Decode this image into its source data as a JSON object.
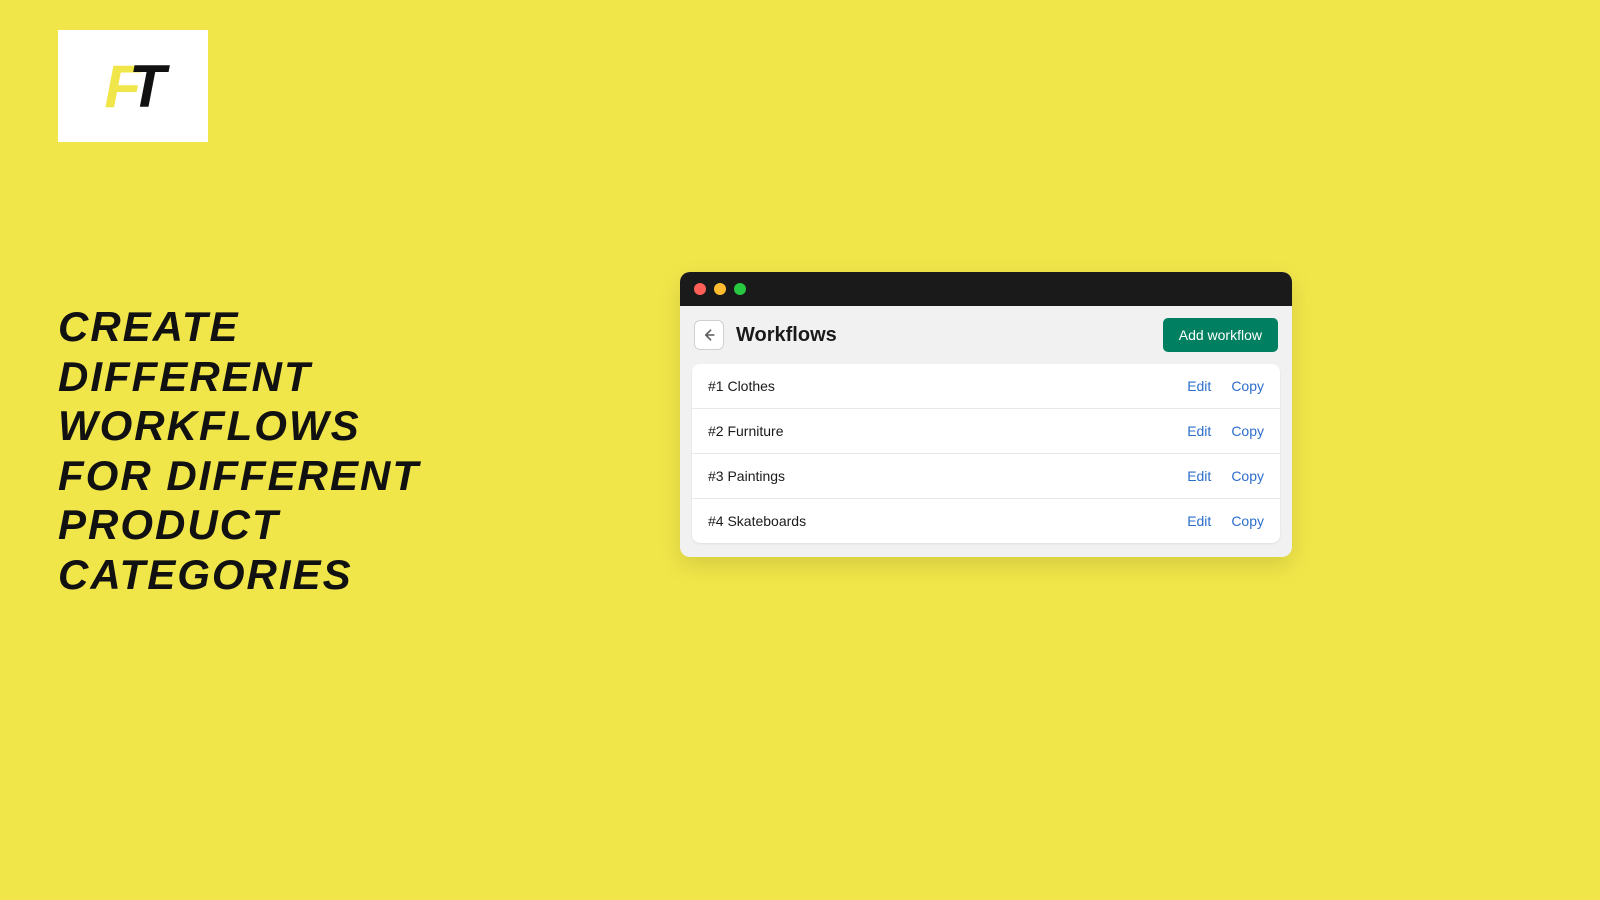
{
  "logo": {
    "letter1": "F",
    "letter2": "T"
  },
  "headline": {
    "line1": "CREATE",
    "line2": "DIFFERENT",
    "line3": "WORKFLOWS",
    "line4": "FOR DIFFERENT",
    "line5": "PRODUCT",
    "line6": "CATEGORIES"
  },
  "window": {
    "title": "Workflows",
    "add_button": "Add workflow",
    "rows": [
      {
        "name": "#1 Clothes",
        "edit": "Edit",
        "copy": "Copy"
      },
      {
        "name": "#2 Furniture",
        "edit": "Edit",
        "copy": "Copy"
      },
      {
        "name": "#3 Paintings",
        "edit": "Edit",
        "copy": "Copy"
      },
      {
        "name": "#4 Skateboards",
        "edit": "Edit",
        "copy": "Copy"
      }
    ]
  }
}
